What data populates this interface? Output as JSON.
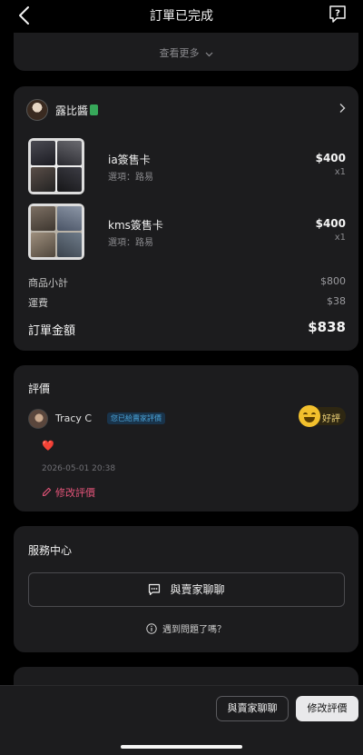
{
  "header": {
    "title": "訂單已完成"
  },
  "more": {
    "label": "查看更多"
  },
  "order": {
    "seller_name": "露比醬",
    "items": [
      {
        "name": "ia簽售卡",
        "option": "選項：路易",
        "price": "$400",
        "qty": "x1"
      },
      {
        "name": "kms簽售卡",
        "option": "選項：路易",
        "price": "$400",
        "qty": "x1"
      }
    ],
    "subtotal_label": "商品小計",
    "subtotal_value": "$800",
    "shipping_label": "運費",
    "shipping_value": "$38",
    "total_label": "訂單金額",
    "total_value": "$838"
  },
  "review": {
    "title": "評價",
    "reviewer": "Tracy C",
    "tag": "您已給賣家評價",
    "rating": "好評",
    "comment": "❤️",
    "date": "2026-05-01 20:38",
    "edit_label": "修改評價"
  },
  "service": {
    "title": "服務中心",
    "chat_label": "與賣家聊聊",
    "problem_label": "遇到問題了嗎？"
  },
  "bottom_bar": {
    "chat_button": "與賣家聊聊",
    "edit_button": "修改評價"
  },
  "colors": {
    "background": "#000000",
    "card": "#1c1c1e",
    "accent_pink": "#e5557a",
    "tag_blue": "#4aa3d8",
    "rating_yellow": "#f2c02d"
  }
}
